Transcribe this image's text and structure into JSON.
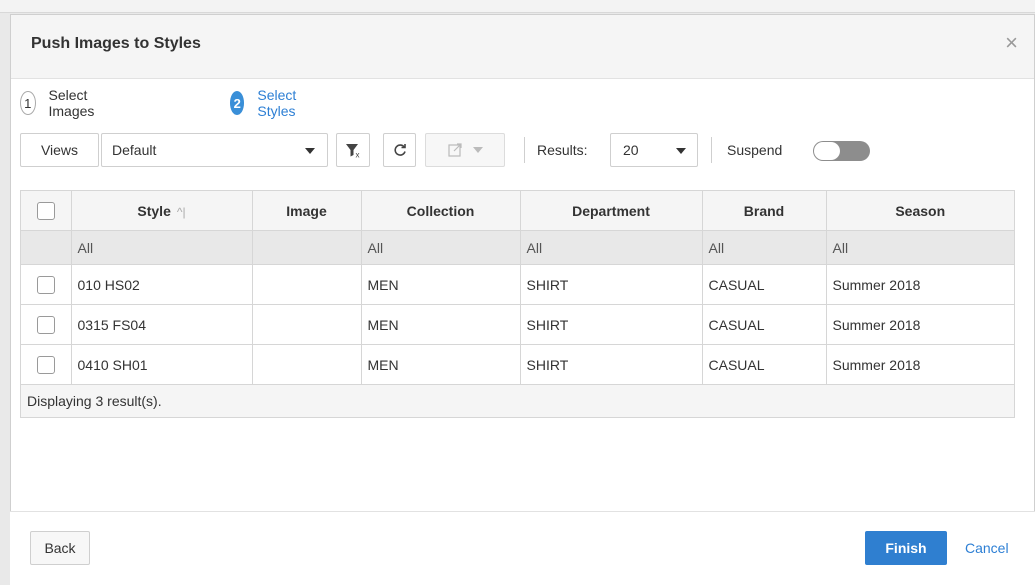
{
  "dialog": {
    "title": "Push Images to Styles",
    "close_glyph": "×"
  },
  "steps": [
    {
      "number": "1",
      "label": "Select Images",
      "state": "inactive"
    },
    {
      "number": "2",
      "label": "Select Styles",
      "state": "active"
    }
  ],
  "toolbar": {
    "views_label": "Views",
    "view_select_value": "Default",
    "filter_icon": "clear-filter-icon",
    "refresh_icon": "refresh-icon",
    "export_icon": "export-icon",
    "results_label": "Results:",
    "results_value": "20",
    "suspend_label": "Suspend",
    "suspend_on": false
  },
  "grid": {
    "columns": [
      "Style",
      "Image",
      "Collection",
      "Department",
      "Brand",
      "Season"
    ],
    "sort_indicator": "^|",
    "filters": [
      "All",
      "",
      "All",
      "All",
      "All",
      "All"
    ],
    "rows": [
      [
        "010 HS02",
        "",
        "MEN",
        "SHIRT",
        "CASUAL",
        "Summer 2018"
      ],
      [
        "0315 FS04",
        "",
        "MEN",
        "SHIRT",
        "CASUAL",
        "Summer 2018"
      ],
      [
        "0410 SH01",
        "",
        "MEN",
        "SHIRT",
        "CASUAL",
        "Summer 2018"
      ]
    ],
    "footer_text": "Displaying 3 result(s)."
  },
  "footer": {
    "back_label": "Back",
    "finish_label": "Finish",
    "cancel_label": "Cancel"
  },
  "colors": {
    "accent": "#2f7fd0",
    "link": "#2d7fd4",
    "toggle_off": "#8d8d8d"
  }
}
